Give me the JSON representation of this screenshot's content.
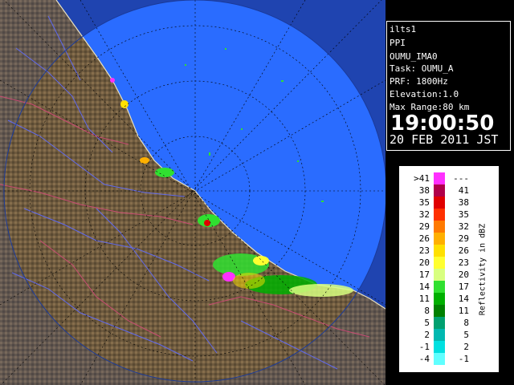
{
  "info": {
    "site": "ilts1",
    "scan_type": "PPI",
    "product": "OUMU_IMA0",
    "task": "Task: OUMU_A",
    "prf": "PRF: 1800Hz",
    "elevation": "Elevation:1.0",
    "max_range": "Max Range:80 km",
    "time": "19:00:50",
    "date": "20 FEB 2011 JST"
  },
  "legend": {
    "unit": "Reflectivity in dBZ",
    "rows": [
      {
        "lo": ">41",
        "hi": "---",
        "color": "#ff30ff"
      },
      {
        "lo": "38",
        "hi": "41",
        "color": "#b0004a"
      },
      {
        "lo": "35",
        "hi": "38",
        "color": "#e00000"
      },
      {
        "lo": "32",
        "hi": "35",
        "color": "#ff3000"
      },
      {
        "lo": "29",
        "hi": "32",
        "color": "#ff7a00"
      },
      {
        "lo": "26",
        "hi": "29",
        "color": "#ffb000"
      },
      {
        "lo": "23",
        "hi": "26",
        "color": "#ffe000"
      },
      {
        "lo": "20",
        "hi": "23",
        "color": "#ffff30"
      },
      {
        "lo": "17",
        "hi": "20",
        "color": "#d8ff80"
      },
      {
        "lo": "14",
        "hi": "17",
        "color": "#30e030"
      },
      {
        "lo": "11",
        "hi": "14",
        "color": "#00b000"
      },
      {
        "lo": "8",
        "hi": "11",
        "color": "#008000"
      },
      {
        "lo": "5",
        "hi": "8",
        "color": "#00a070"
      },
      {
        "lo": "2",
        "hi": "5",
        "color": "#00b8b0"
      },
      {
        "lo": "-1",
        "hi": "2",
        "color": "#00e0e0"
      },
      {
        "lo": "-4",
        "hi": "-1",
        "color": "#60ffff"
      }
    ]
  },
  "colors": {
    "sea": "#2a6cff",
    "sea_outer": "#1f4fd8",
    "land": "#6e5a3e",
    "land_high": "#a58a62",
    "river": "#5f6cff",
    "border": "#d24a78",
    "echo": "#30e030"
  }
}
